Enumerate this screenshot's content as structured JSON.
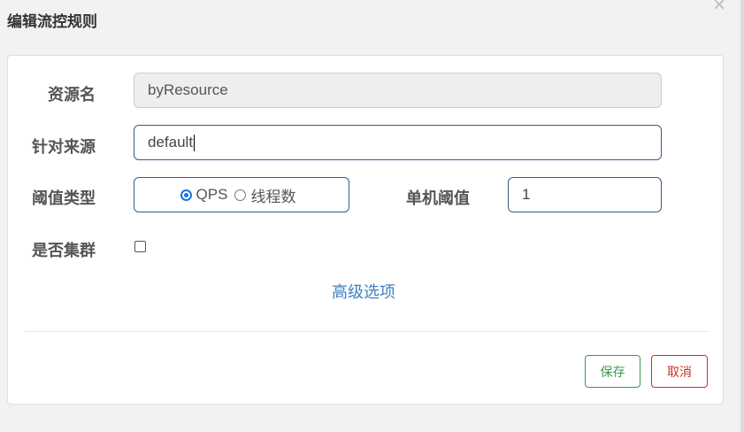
{
  "dialog": {
    "title": "编辑流控规则",
    "close_symbol": "×"
  },
  "form": {
    "resource_label": "资源名",
    "resource_value": "byResource",
    "source_label": "针对来源",
    "source_value": "default",
    "threshold_type_label": "阈值类型",
    "threshold_type_options": [
      "QPS",
      "线程数"
    ],
    "threshold_type_selected": "QPS",
    "single_threshold_label": "单机阈值",
    "single_threshold_value": "1",
    "cluster_label": "是否集群",
    "cluster_checked": false,
    "advanced_link": "高级选项"
  },
  "buttons": {
    "save": "保存",
    "cancel": "取消"
  }
}
